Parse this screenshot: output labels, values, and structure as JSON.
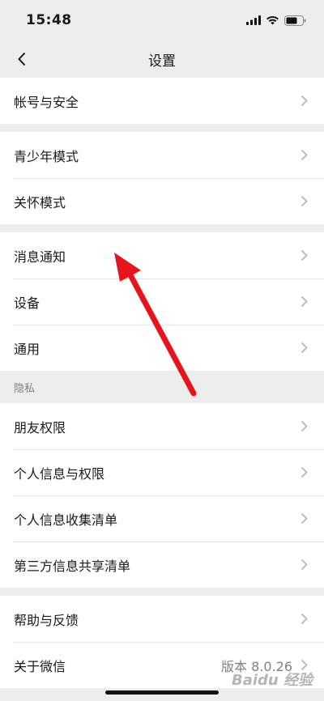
{
  "status_bar": {
    "time": "15:48",
    "icons": [
      "signal-icon",
      "wifi-icon",
      "battery-icon"
    ]
  },
  "nav": {
    "title": "设置",
    "back_icon": "chevron-left-icon"
  },
  "groups": {
    "account": [
      "帐号与安全"
    ],
    "modes": [
      "青少年模式",
      "关怀模式"
    ],
    "general": [
      "消息通知",
      "设备",
      "通用"
    ],
    "privacy_label": "隐私",
    "privacy": [
      "朋友权限",
      "个人信息与权限",
      "个人信息收集清单",
      "第三方信息共享清单"
    ],
    "about": {
      "help": "帮助与反馈",
      "about_label": "关于微信",
      "version": "版本 8.0.26"
    }
  },
  "watermark": "Baidu 经验",
  "colors": {
    "background": "#ededed",
    "row_bg": "#ffffff",
    "arrow": "#e8141c",
    "chevron": "#b2b2b2"
  }
}
